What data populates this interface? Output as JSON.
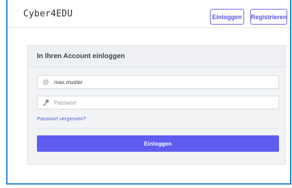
{
  "header": {
    "brand": "Cyber4EDU",
    "login_label": "Einloggen",
    "register_label": "Registrieren"
  },
  "login_card": {
    "title": "In Ihren Account einloggen",
    "username": {
      "icon": "at-icon",
      "icon_glyph": "@",
      "value": "max.muster"
    },
    "password": {
      "icon": "key-icon",
      "icon_glyph": "🔑",
      "value": "",
      "placeholder": "Passwort"
    },
    "forgot_label": "Passwort vergessen?",
    "submit_label": "Einloggen"
  },
  "colors": {
    "accent": "#5e5df0",
    "frame_border": "#2d85d6",
    "link": "#4f5fd6"
  }
}
